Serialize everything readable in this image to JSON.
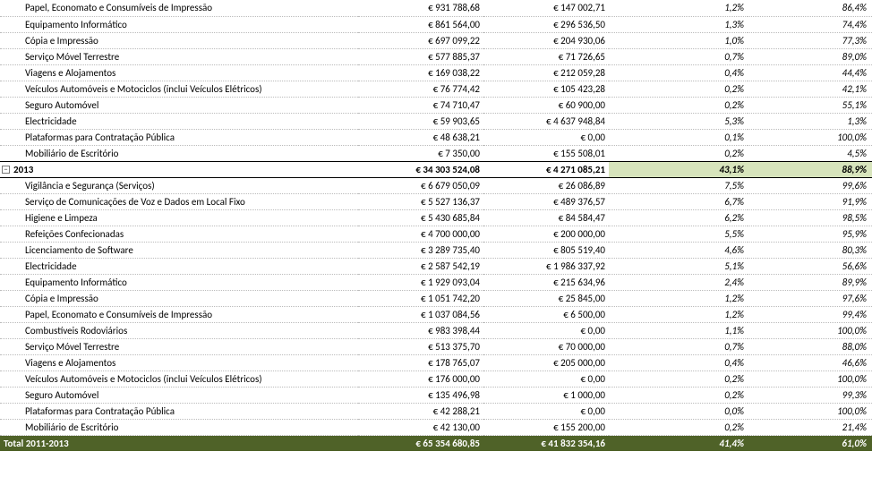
{
  "section1": {
    "rows": [
      {
        "label": "Papel, Economato e Consumíveis de Impressão",
        "v1": "€  931 788,68",
        "v2": "€  147 002,71",
        "p1": "1,2%",
        "p2": "86,4%"
      },
      {
        "label": "Equipamento Informático",
        "v1": "€  861 564,00",
        "v2": "€  296 536,50",
        "p1": "1,3%",
        "p2": "74,4%"
      },
      {
        "label": "Cópia e Impressão",
        "v1": "€  697 099,22",
        "v2": "€  204 930,06",
        "p1": "1,0%",
        "p2": "77,3%"
      },
      {
        "label": "Serviço Móvel Terrestre",
        "v1": "€  577 885,37",
        "v2": "€   71 726,65",
        "p1": "0,7%",
        "p2": "89,0%"
      },
      {
        "label": "Viagens e Alojamentos",
        "v1": "€  169 038,22",
        "v2": "€  212 059,28",
        "p1": "0,4%",
        "p2": "44,4%"
      },
      {
        "label": "Veículos Automóveis e Motociclos (inclui Veículos Elétricos)",
        "v1": "€   76 774,42",
        "v2": "€  105 423,28",
        "p1": "0,2%",
        "p2": "42,1%"
      },
      {
        "label": "Seguro Automóvel",
        "v1": "€   74 710,47",
        "v2": "€   60 900,00",
        "p1": "0,2%",
        "p2": "55,1%"
      },
      {
        "label": "Electricidade",
        "v1": "€   59 903,65",
        "v2": "€ 4 637 948,84",
        "p1": "5,3%",
        "p2": "1,3%"
      },
      {
        "label": "Plataformas para Contratação Pública",
        "v1": "€   48 638,21",
        "v2": "€    0,00",
        "p1": "0,1%",
        "p2": "100,0%"
      },
      {
        "label": "Mobiliário de Escritório",
        "v1": "€   7 350,00",
        "v2": "€  155 508,01",
        "p1": "0,2%",
        "p2": "4,5%"
      }
    ]
  },
  "group2013": {
    "label": "2013",
    "v1": "€ 34 303 524,08",
    "v2": "€ 4 271 085,21",
    "p1": "43,1%",
    "p2": "88,9%"
  },
  "section2": {
    "rows": [
      {
        "label": "Vigilância e Segurança (Serviços)",
        "v1": "€ 6 679 050,09",
        "v2": "€   26 086,89",
        "p1": "7,5%",
        "p2": "99,6%"
      },
      {
        "label": "Serviço de Comunicações de Voz e Dados em Local Fixo",
        "v1": "€ 5 527 136,37",
        "v2": "€  489 376,57",
        "p1": "6,7%",
        "p2": "91,9%"
      },
      {
        "label": "Higiene e Limpeza",
        "v1": "€ 5 430 685,84",
        "v2": "€   84 584,47",
        "p1": "6,2%",
        "p2": "98,5%"
      },
      {
        "label": "Refeições Confecionadas",
        "v1": "€ 4 700 000,00",
        "v2": "€  200 000,00",
        "p1": "5,5%",
        "p2": "95,9%"
      },
      {
        "label": "Licenciamento de Software",
        "v1": "€ 3 289 735,40",
        "v2": "€  805 519,40",
        "p1": "4,6%",
        "p2": "80,3%"
      },
      {
        "label": "Electricidade",
        "v1": "€ 2 587 542,19",
        "v2": "€ 1 986 337,92",
        "p1": "5,1%",
        "p2": "56,6%"
      },
      {
        "label": "Equipamento Informático",
        "v1": "€ 1 929 093,04",
        "v2": "€  215 634,96",
        "p1": "2,4%",
        "p2": "89,9%"
      },
      {
        "label": "Cópia e Impressão",
        "v1": "€ 1 051 742,20",
        "v2": "€   25 845,00",
        "p1": "1,2%",
        "p2": "97,6%"
      },
      {
        "label": "Papel, Economato e Consumíveis de Impressão",
        "v1": "€ 1 037 084,56",
        "v2": "€   6 500,00",
        "p1": "1,2%",
        "p2": "99,4%"
      },
      {
        "label": "Combustíveis Rodoviários",
        "v1": "€  983 398,44",
        "v2": "€    0,00",
        "p1": "1,1%",
        "p2": "100,0%"
      },
      {
        "label": "Serviço Móvel Terrestre",
        "v1": "€  513 375,70",
        "v2": "€   70 000,00",
        "p1": "0,7%",
        "p2": "88,0%"
      },
      {
        "label": "Viagens e Alojamentos",
        "v1": "€  178 765,07",
        "v2": "€  205 000,00",
        "p1": "0,4%",
        "p2": "46,6%"
      },
      {
        "label": "Veículos Automóveis e Motociclos (inclui Veículos Elétricos)",
        "v1": "€  176 000,00",
        "v2": "€    0,00",
        "p1": "0,2%",
        "p2": "100,0%"
      },
      {
        "label": "Seguro Automóvel",
        "v1": "€  135 496,98",
        "v2": "€   1 000,00",
        "p1": "0,2%",
        "p2": "99,3%"
      },
      {
        "label": "Plataformas para Contratação Pública",
        "v1": "€   42 288,21",
        "v2": "€    0,00",
        "p1": "0,0%",
        "p2": "100,0%"
      },
      {
        "label": "Mobiliário de Escritório",
        "v1": "€   42 130,00",
        "v2": "€  155 200,00",
        "p1": "0,2%",
        "p2": "21,4%"
      }
    ]
  },
  "total": {
    "label": "Total 2011-2013",
    "v1": "€ 65 354 680,85",
    "v2": "€  41 832 354,16",
    "p1": "41,4%",
    "p2": "61,0%"
  }
}
